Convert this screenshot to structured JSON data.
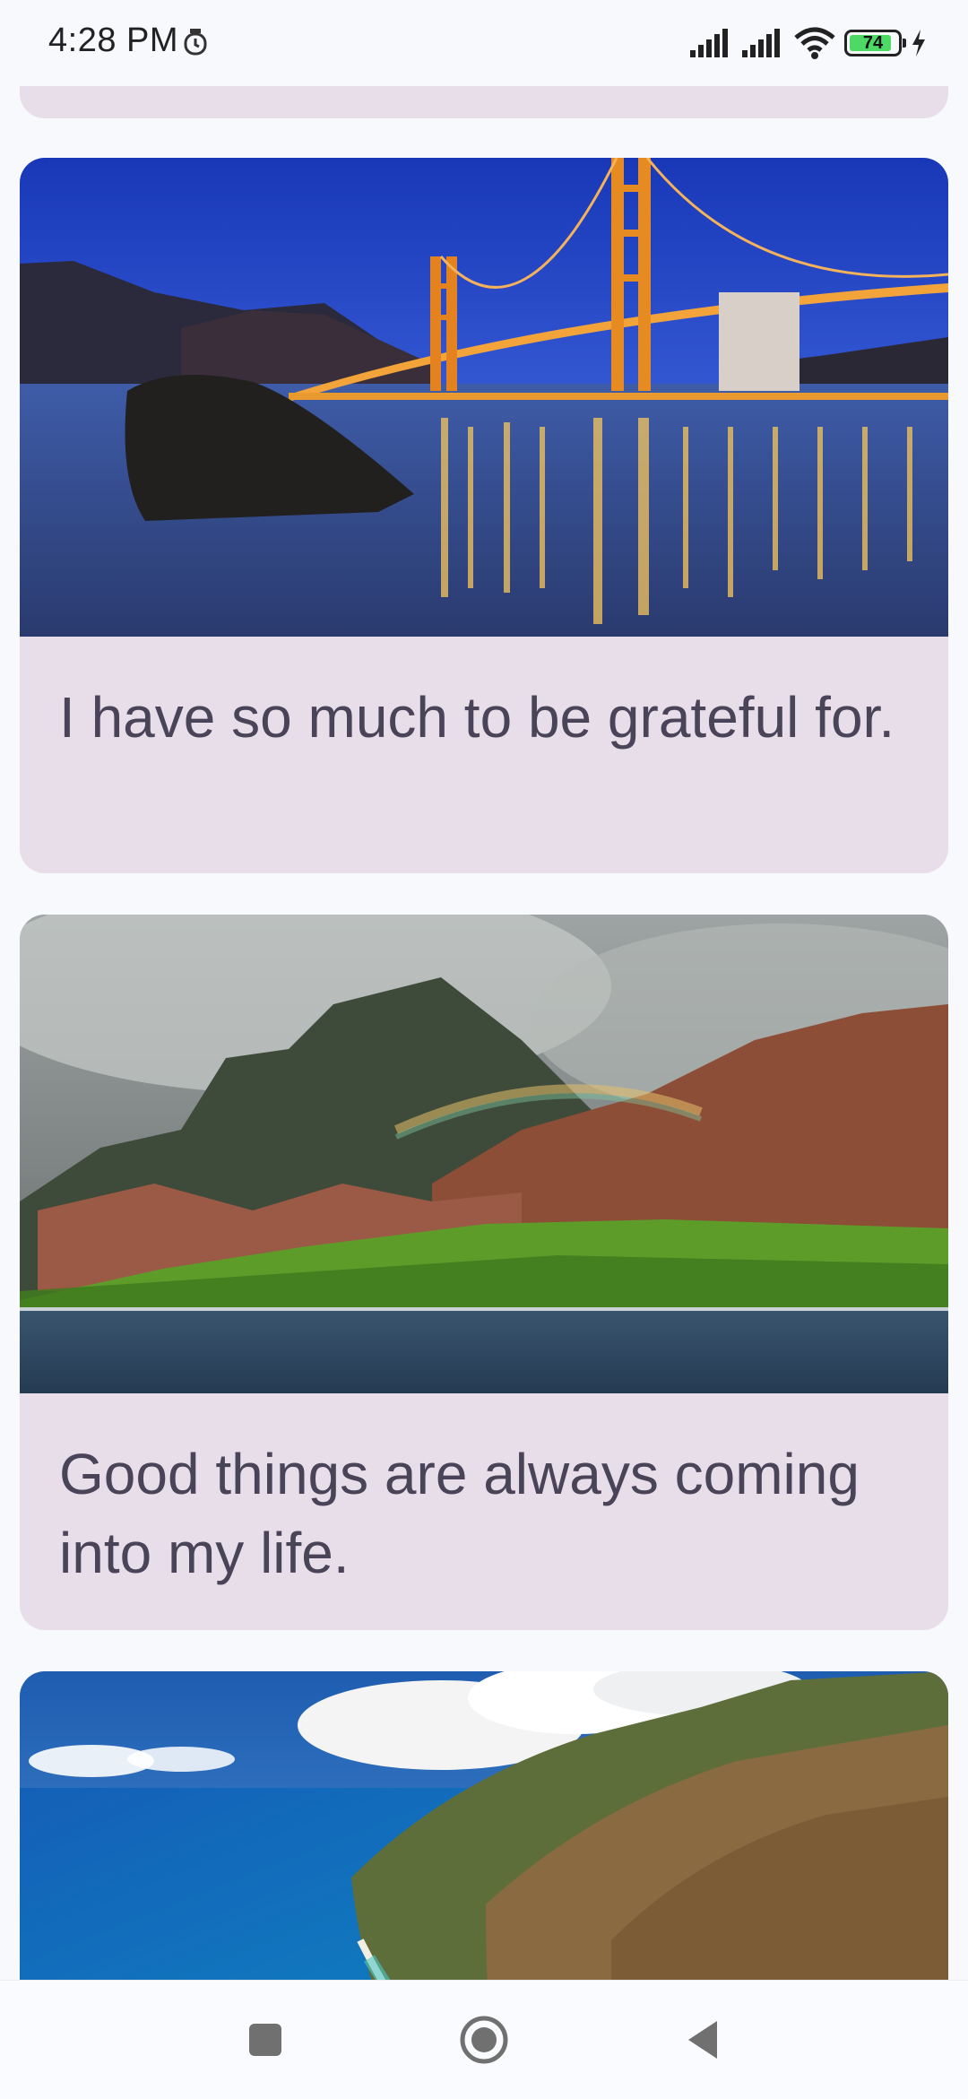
{
  "status_bar": {
    "time": "4:28 PM",
    "battery_level": "74",
    "icons": [
      "alarm-icon",
      "signal-icon",
      "signal-icon",
      "wifi-icon",
      "battery-icon",
      "charging-icon"
    ]
  },
  "cards": [
    {
      "text": "",
      "image": "partial-card"
    },
    {
      "text": "I have so much to be grateful for.",
      "image": "golden-gate-bridge-night"
    },
    {
      "text": "Good things are always coming into my life.",
      "image": "mountain-coast-rainbow"
    },
    {
      "text": "",
      "image": "coastal-cliffs-ocean"
    }
  ],
  "nav_bar": {
    "icons": [
      "recent-apps-icon",
      "home-icon",
      "back-icon"
    ]
  }
}
